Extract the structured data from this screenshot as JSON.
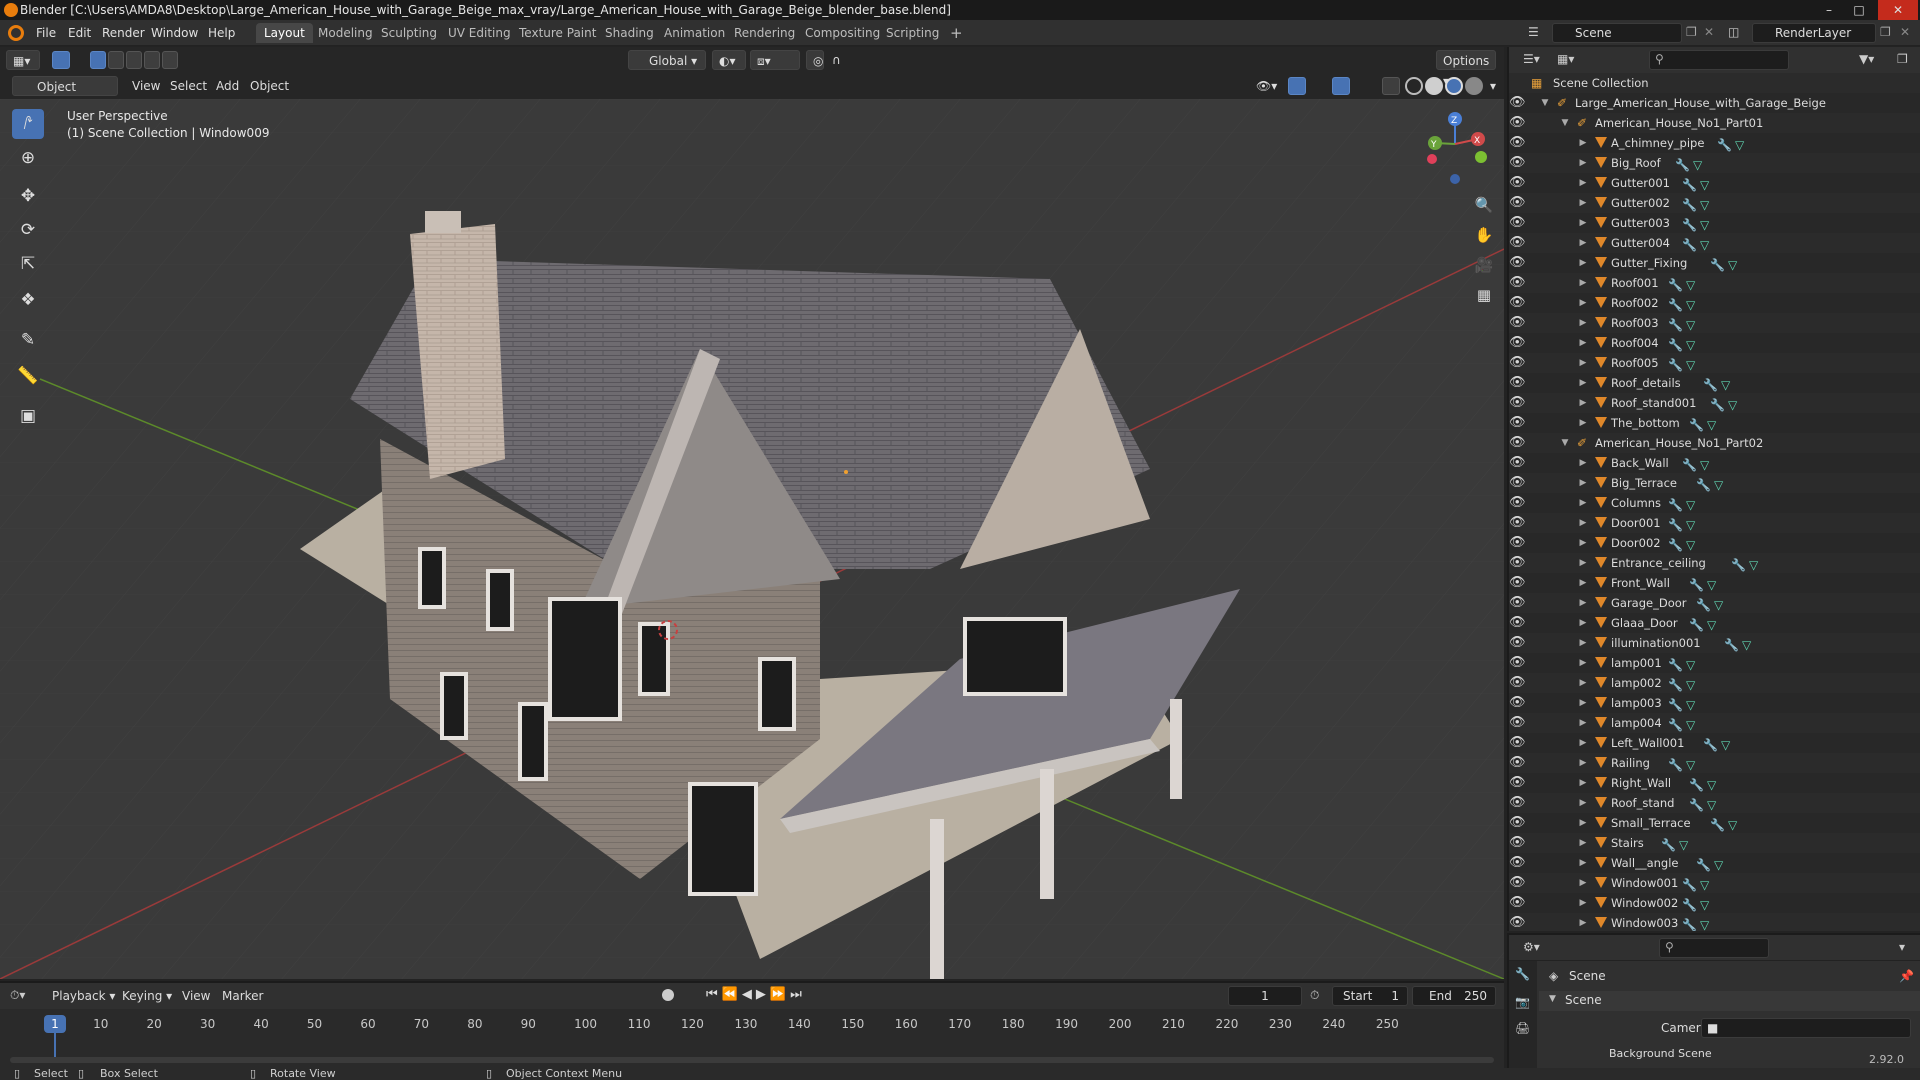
{
  "title": "Blender [C:\\Users\\AMDA8\\Desktop\\Large_American_House_with_Garage_Beige_max_vray/Large_American_House_with_Garage_Beige_blender_base.blend]",
  "menu": [
    "File",
    "Edit",
    "Render",
    "Window",
    "Help"
  ],
  "workspaces": [
    "Layout",
    "Modeling",
    "Sculpting",
    "UV Editing",
    "Texture Paint",
    "Shading",
    "Animation",
    "Rendering",
    "Compositing",
    "Scripting"
  ],
  "active_workspace": "Layout",
  "scene_name": "Scene",
  "view_layer": "RenderLayer",
  "viewport_header": {
    "transform_orientation": "Global",
    "options": "Options",
    "mode": "Object Mode",
    "view": "View",
    "select": "Select",
    "add": "Add",
    "object": "Object"
  },
  "viewport": {
    "perspective": "User Perspective",
    "collection_info": "(1) Scene Collection | Window009",
    "gizmo_axes": [
      "X",
      "Y",
      "Z"
    ]
  },
  "outliner": {
    "root": "Scene Collection",
    "collection": "Large_American_House_with_Garage_Beige",
    "groups": [
      {
        "name": "American_House_No1_Part01",
        "children": [
          "A_chimney_pipe",
          "Big_Roof",
          "Gutter001",
          "Gutter002",
          "Gutter003",
          "Gutter004",
          "Gutter_Fixing",
          "Roof001",
          "Roof002",
          "Roof003",
          "Roof004",
          "Roof005",
          "Roof_details",
          "Roof_stand001",
          "The_bottom"
        ]
      },
      {
        "name": "American_House_No1_Part02",
        "children": [
          "Back_Wall",
          "Big_Terrace",
          "Columns",
          "Door001",
          "Door002",
          "Entrance_ceiling",
          "Front_Wall",
          "Garage_Door",
          "Glaaa_Door",
          "illumination001",
          "lamp001",
          "lamp002",
          "lamp003",
          "lamp004",
          "Left_Wall001",
          "Railing",
          "Right_Wall",
          "Roof_stand",
          "Small_Terrace",
          "Stairs",
          "Wall__angle",
          "Window001",
          "Window002",
          "Window003"
        ]
      }
    ]
  },
  "properties": {
    "context": "Scene",
    "panel": "Scene",
    "camera_label": "Camera",
    "background_label": "Background Scene"
  },
  "timeline": {
    "playback": "Playback",
    "keying": "Keying",
    "view": "View",
    "marker": "Marker",
    "current_frame": "1",
    "start_label": "Start",
    "start": "1",
    "end_label": "End",
    "end": "250",
    "ticks": [
      "1",
      "10",
      "20",
      "30",
      "40",
      "50",
      "60",
      "70",
      "80",
      "90",
      "100",
      "110",
      "120",
      "130",
      "140",
      "150",
      "160",
      "170",
      "180",
      "190",
      "200",
      "210",
      "220",
      "230",
      "240",
      "250"
    ]
  },
  "statusbar": {
    "select": "Select",
    "box_select": "Box Select",
    "rotate": "Rotate View",
    "context_menu": "Object Context Menu",
    "version": "2.92.0"
  },
  "colors": {
    "accent": "#4772b3",
    "orange": "#e0882a",
    "mesh": "#5fd3b0"
  }
}
